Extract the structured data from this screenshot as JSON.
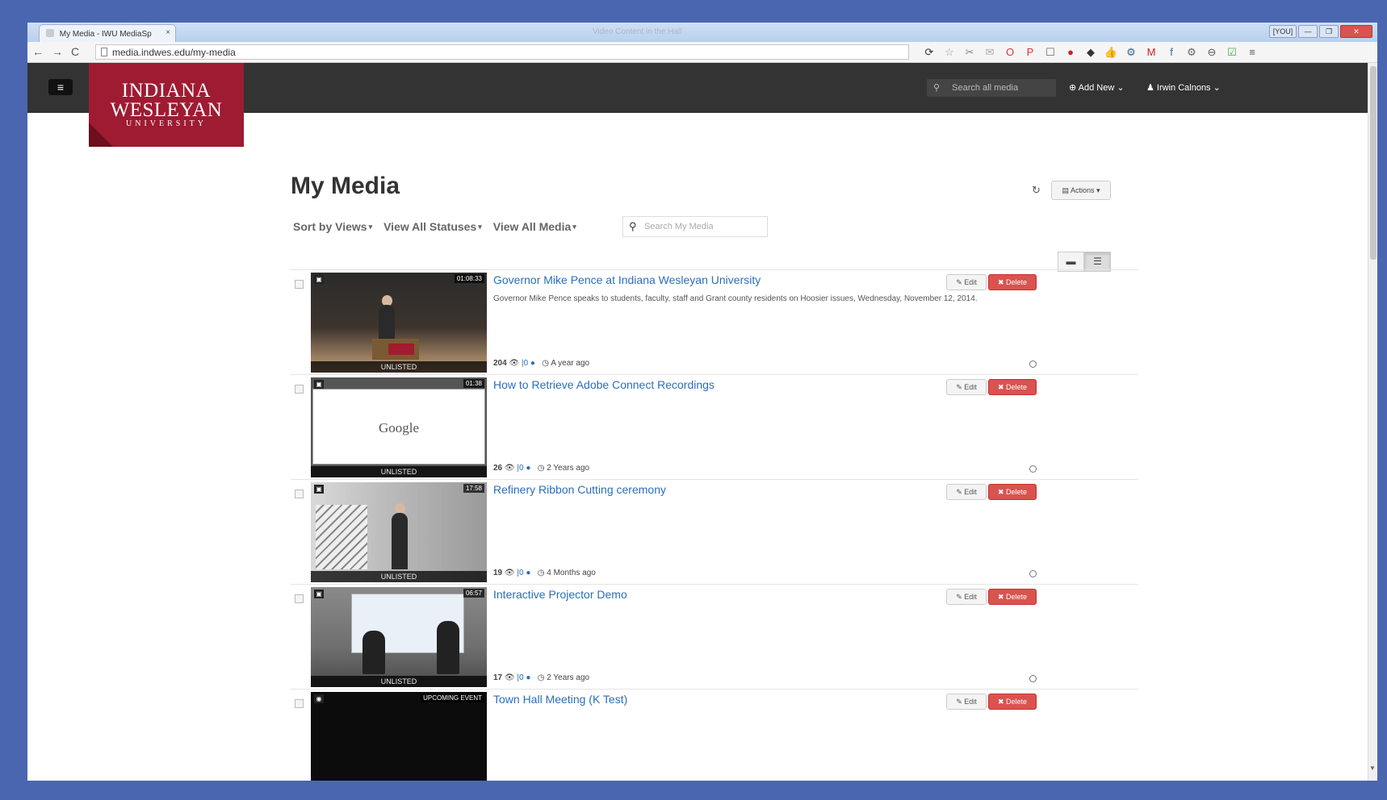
{
  "browser": {
    "tab_title": "My Media - IWU MediaSp",
    "tab_close": "×",
    "window_title": "Video Content in the Hall",
    "win_user": "[YOU]",
    "win_min": "—",
    "win_max": "❐",
    "win_close": "✕",
    "back": "←",
    "forward": "→",
    "reload": "C",
    "url": "media.indwes.edu/my-media",
    "ext_icons": [
      "⟳",
      "☆",
      "✂",
      "✉",
      "O",
      "P",
      "☐",
      "●",
      "◆",
      "👍",
      "⚙",
      "M",
      "f",
      "⚙",
      "⊖",
      "☑",
      "≡"
    ]
  },
  "site": {
    "menu_icon": "≡",
    "logo_line1": "INDIANA",
    "logo_line2": "WESLEYAN",
    "logo_line3": "UNIVERSITY",
    "search_icon": "⚲",
    "search_placeholder": "Search all media",
    "add_new": "⊕ Add New ⌄",
    "user_menu": "♟ Irwin Calnons ⌄"
  },
  "page": {
    "title": "My Media",
    "refresh_icon": "↻",
    "actions_label": "▤ Actions ▾",
    "filters": [
      {
        "label": "Sort by Views",
        "caret": "▾"
      },
      {
        "label": "View All Statuses",
        "caret": "▾"
      },
      {
        "label": "View All Media",
        "caret": "▾"
      }
    ],
    "search_icon": "⚲",
    "search_placeholder": "Search My Media",
    "view_list_icon": "▬",
    "view_detail_icon": "☰"
  },
  "media": [
    {
      "type_icon": "▣",
      "duration": "01:08:33",
      "status": "UNLISTED",
      "title": "Governor Mike Pence at Indiana Wesleyan University",
      "description": "Governor Mike Pence speaks to students, faculty, staff and Grant county residents on Hoosier issues, Wednesday, November 12, 2014.",
      "views": "204",
      "comments": "0",
      "age": "A year ago",
      "edit": "✎ Edit",
      "delete": "✖ Delete"
    },
    {
      "type_icon": "▣",
      "duration": "01:38",
      "status": "UNLISTED",
      "title": "How to Retrieve Adobe Connect Recordings",
      "description": "",
      "views": "26",
      "comments": "0",
      "age": "2 Years ago",
      "edit": "✎ Edit",
      "delete": "✖ Delete",
      "screen_text": "Google"
    },
    {
      "type_icon": "▣",
      "duration": "17:58",
      "status": "UNLISTED",
      "title": "Refinery Ribbon Cutting ceremony",
      "description": "",
      "views": "19",
      "comments": "0",
      "age": "4 Months ago",
      "edit": "✎ Edit",
      "delete": "✖ Delete"
    },
    {
      "type_icon": "▣",
      "duration": "06:57",
      "status": "UNLISTED",
      "title": "Interactive Projector Demo",
      "description": "",
      "views": "17",
      "comments": "0",
      "age": "2 Years ago",
      "edit": "✎ Edit",
      "delete": "✖ Delete"
    },
    {
      "type_icon": "◉",
      "duration": "UPCOMING EVENT",
      "status": "",
      "title": "Town Hall Meeting (K Test)",
      "description": "",
      "views": "",
      "comments": "",
      "age": "",
      "edit": "✎ Edit",
      "delete": "✖ Delete"
    }
  ],
  "colors": {
    "accent_link": "#2a6ebb",
    "delete_red": "#d9534f",
    "logo_red": "#9e1b32",
    "header_dark": "#333333"
  }
}
